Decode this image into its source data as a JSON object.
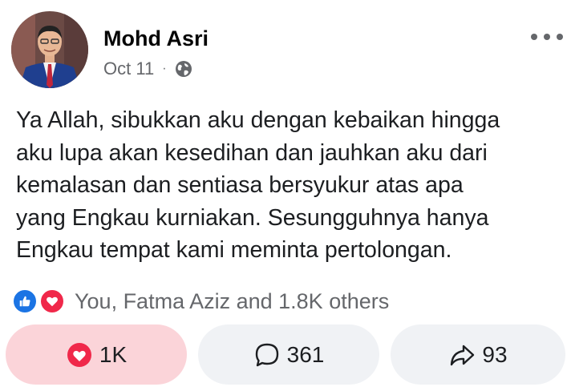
{
  "post": {
    "author": "Mohd Asri",
    "date": "Oct 11",
    "separator": "·",
    "audience_icon": "globe-icon",
    "more_icon": "more-options-icon",
    "text_lines": [
      "Ya Allah, sibukkan aku dengan kebaikan hingga",
      "aku lupa akan kesedihan dan jauhkan aku dari",
      "kemalasan dan sentiasa bersyukur atas apa",
      "yang Engkau kurniakan. Sesungguhnya hanya",
      "Engkau tempat kami meminta pertolongan."
    ]
  },
  "reactions": {
    "icons": [
      "like-reaction-icon",
      "love-reaction-icon"
    ],
    "summary": "You, Fatma Aziz and 1.8K others"
  },
  "actions": {
    "like": {
      "icon": "heart-icon",
      "count": "1K",
      "active": true
    },
    "comment": {
      "icon": "comment-bubble-icon",
      "count": "361"
    },
    "share": {
      "icon": "share-arrow-icon",
      "count": "93"
    }
  },
  "colors": {
    "like_blue": "#1b74e4",
    "love_red": "#f0284a",
    "active_like_bg": "#fbd4d9",
    "button_bg": "#f0f2f5",
    "secondary_text": "#65676b"
  }
}
